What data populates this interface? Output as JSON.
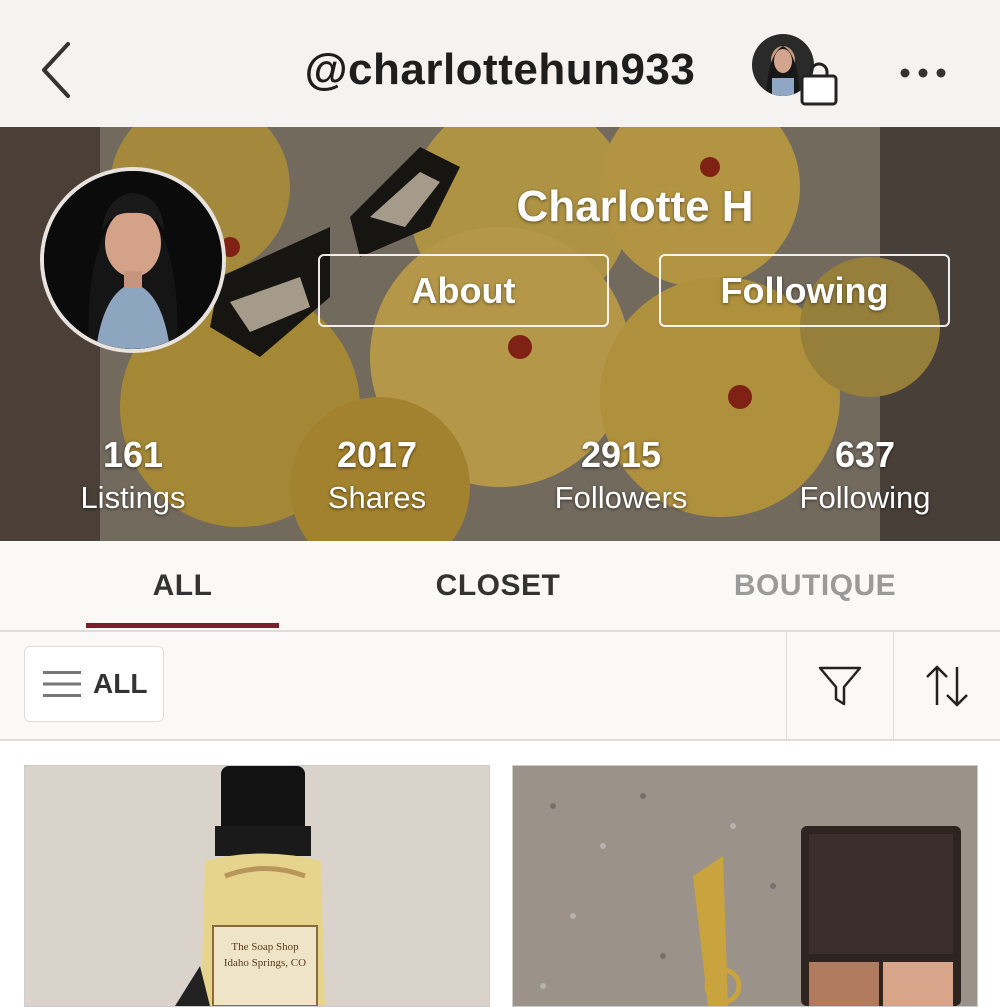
{
  "header": {
    "handle": "@charlottehun933",
    "back_icon": "chevron-left-icon",
    "bag_icon": "shopping-bag-icon",
    "more_icon": "more-horizontal-icon"
  },
  "profile": {
    "name": "Charlotte H",
    "about_label": "About",
    "following_button_label": "Following"
  },
  "stats": [
    {
      "value": "161",
      "label": "Listings"
    },
    {
      "value": "2017",
      "label": "Shares"
    },
    {
      "value": "2915",
      "label": "Followers"
    },
    {
      "value": "637",
      "label": "Following"
    }
  ],
  "tabs": [
    {
      "label": "ALL",
      "active": true
    },
    {
      "label": "CLOSET",
      "active": false
    },
    {
      "label": "BOUTIQUE",
      "active": false
    }
  ],
  "filters": {
    "all_label": "ALL",
    "menu_icon": "hamburger-menu-icon",
    "filter_icon": "filter-funnel-icon",
    "sort_icon": "sort-arrows-icon"
  },
  "listings": [
    {
      "label_line1": "The Soap Shop",
      "label_line2": "Idaho Springs, CO"
    },
    {
      "label_line1": ""
    }
  ],
  "colors": {
    "accent": "#7a1f2c",
    "topbar_bg": "#f5f3f1",
    "inactive_tab": "#9a9a9a"
  }
}
